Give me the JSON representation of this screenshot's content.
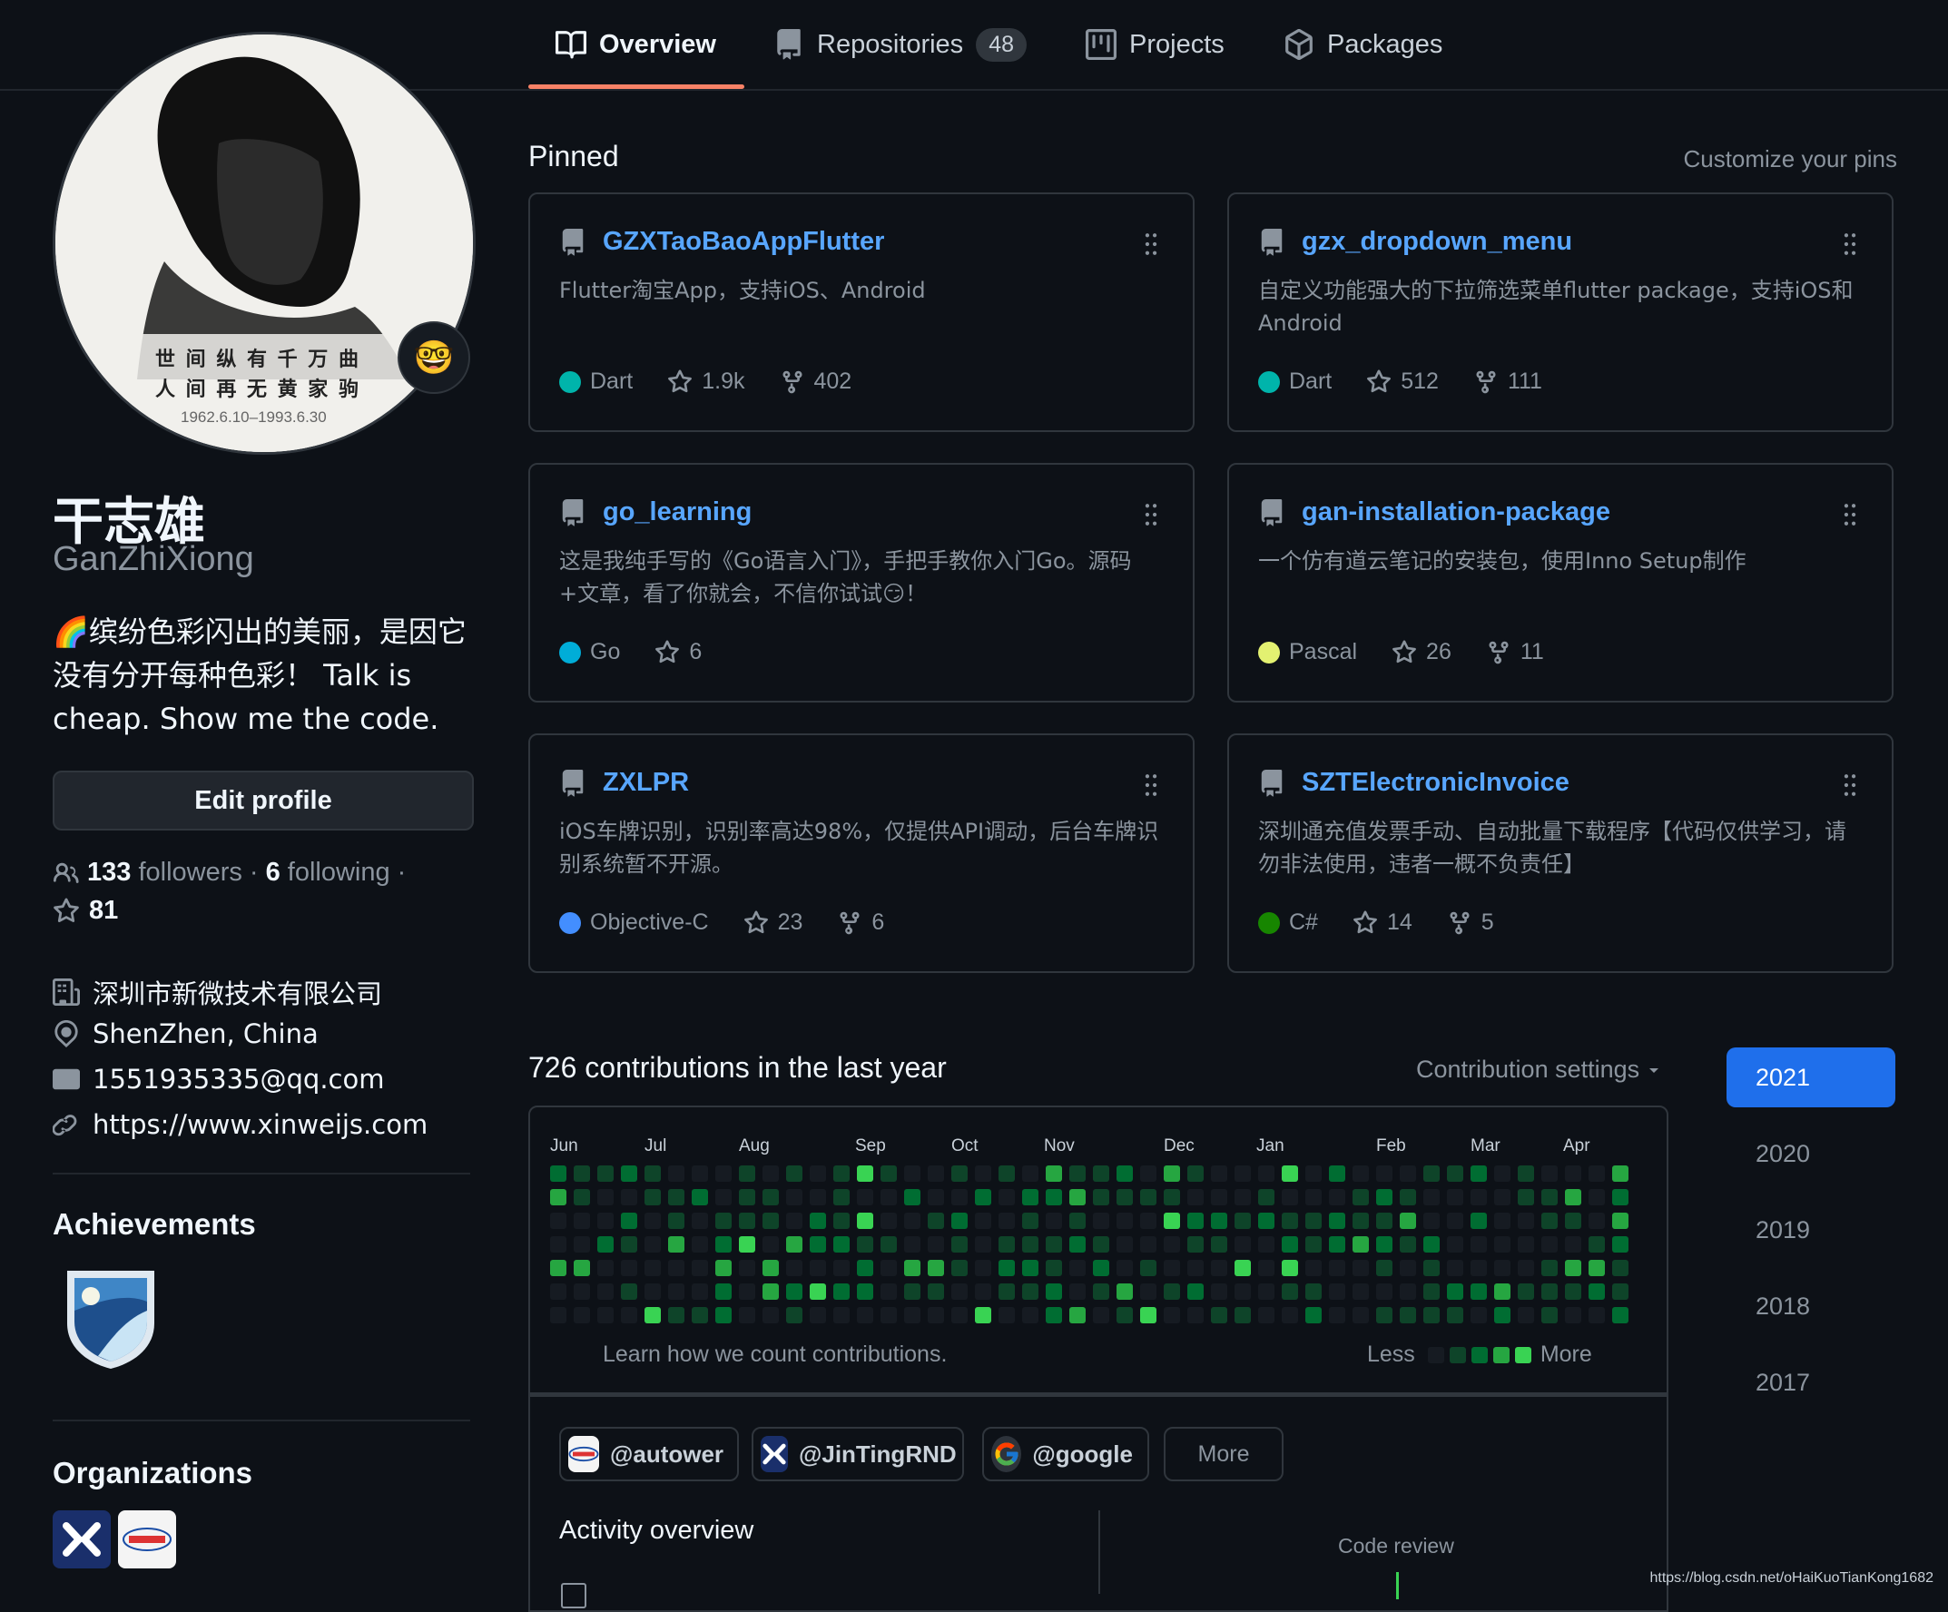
{
  "nav": {
    "tabs": [
      {
        "label": "Overview",
        "icon": "book-icon"
      },
      {
        "label": "Repositories",
        "icon": "repo-icon",
        "count": "48"
      },
      {
        "label": "Projects",
        "icon": "project-icon"
      },
      {
        "label": "Packages",
        "icon": "package-icon"
      }
    ]
  },
  "profile": {
    "avatar_text_line1": "世 间 纵 有 千 万 曲",
    "avatar_text_line2": "人 间 再 无 黄 家 驹",
    "avatar_dates": "1962.6.10–1993.6.30",
    "status_emoji": "🤓",
    "name": "干志雄",
    "login": "GanZhiXiong",
    "bio": "🌈缤纷色彩闪出的美丽，是因它没有分开每种色彩！  Talk is cheap. Show me the code.",
    "edit_label": "Edit profile",
    "followers_count": "133",
    "followers_label": "followers",
    "following_count": "6",
    "following_label": "following",
    "stars": "81",
    "company": "深圳市新微技术有限公司",
    "location": "ShenZhen, China",
    "email": "1551935335@qq.com",
    "website": "https://www.xinweijs.com",
    "achievements_title": "Achievements",
    "organizations_title": "Organizations"
  },
  "pinned": {
    "title": "Pinned",
    "customize": "Customize your pins",
    "repos": [
      {
        "name": "GZXTaoBaoAppFlutter",
        "desc": "Flutter淘宝App，支持iOS、Android",
        "lang": "Dart",
        "lang_color": "#00B4AB",
        "stars": "1.9k",
        "forks": "402"
      },
      {
        "name": "gzx_dropdown_menu",
        "desc": "自定义功能强大的下拉筛选菜单flutter package，支持iOS和Android",
        "lang": "Dart",
        "lang_color": "#00B4AB",
        "stars": "512",
        "forks": "111"
      },
      {
        "name": "go_learning",
        "desc": "这是我纯手写的《Go语言入门》，手把手教你入门Go。源码+文章，看了你就会，不信你试试😏！",
        "lang": "Go",
        "lang_color": "#00ADD8",
        "stars": "6",
        "forks": ""
      },
      {
        "name": "gan-installation-package",
        "desc": "一个仿有道云笔记的安装包，使用Inno Setup制作",
        "lang": "Pascal",
        "lang_color": "#E3F171",
        "stars": "26",
        "forks": "11"
      },
      {
        "name": "ZXLPR",
        "desc": "iOS车牌识别，识别率高达98%，仅提供API调动，后台车牌识别系统暂不开源。",
        "lang": "Objective-C",
        "lang_color": "#438EFF",
        "stars": "23",
        "forks": "6"
      },
      {
        "name": "SZTElectronicInvoice",
        "desc": "深圳通充值发票手动、自动批量下载程序【代码仅供学习，请勿非法使用，违者一概不负责任】",
        "lang": "C#",
        "lang_color": "#178600",
        "stars": "14",
        "forks": "5"
      }
    ]
  },
  "contributions": {
    "title": "726 contributions in the last year",
    "settings_label": "Contribution settings",
    "months": [
      "Jun",
      "Jul",
      "Aug",
      "Sep",
      "Oct",
      "Nov",
      "Dec",
      "Jan",
      "Feb",
      "Mar",
      "Apr"
    ],
    "learn_text": "Learn how we count contributions.",
    "less": "Less",
    "more": "More",
    "level_colors": [
      "#161b22",
      "#0e4429",
      "#006d32",
      "#26a641",
      "#39d353"
    ]
  },
  "years": [
    "2021",
    "2020",
    "2019",
    "2018",
    "2017"
  ],
  "activity": {
    "orgs": [
      {
        "label": "@autower"
      },
      {
        "label": "@JinTingRND"
      },
      {
        "label": "@google"
      }
    ],
    "more_label": "More",
    "overview_title": "Activity overview",
    "code_review": "Code review"
  },
  "watermark": "https://blog.csdn.net/oHaiKuoTianKong1682"
}
